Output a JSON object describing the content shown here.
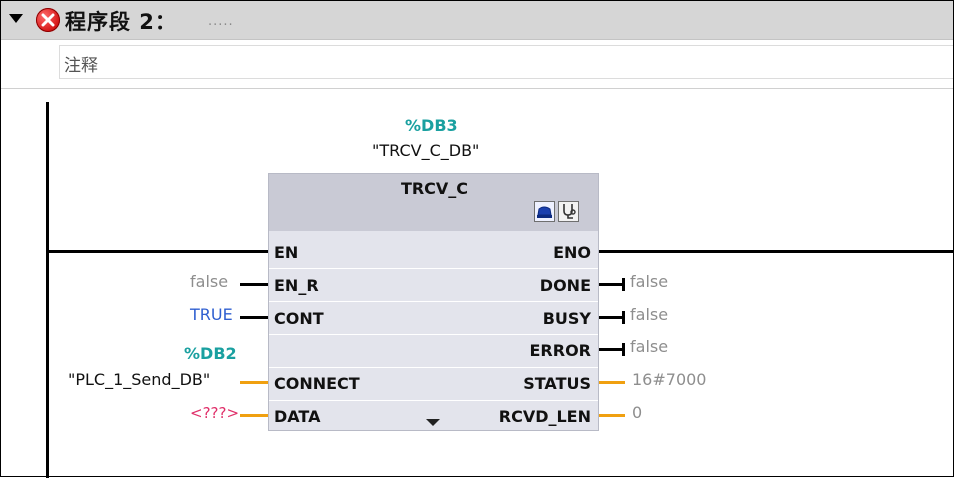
{
  "network": {
    "title": "程序段 2：",
    "dots": ".....",
    "comment": "注释",
    "status_icon": "error-circle-icon"
  },
  "instance_db": {
    "address": "%DB3",
    "name": "\"TRCV_C_DB\""
  },
  "block": {
    "type": "TRCV_C",
    "buttons": [
      "connection-config-icon",
      "diagnostics-icon"
    ],
    "inputs": [
      {
        "pin": "EN",
        "value": ""
      },
      {
        "pin": "EN_R",
        "value": "false"
      },
      {
        "pin": "CONT",
        "value": "TRUE"
      },
      {
        "pin": "CONNECT",
        "value": "\"PLC_1_Send_DB\"",
        "db_address": "%DB2"
      },
      {
        "pin": "DATA",
        "value": "<???>"
      }
    ],
    "outputs": [
      {
        "pin": "ENO",
        "value": ""
      },
      {
        "pin": "DONE",
        "value": "false"
      },
      {
        "pin": "BUSY",
        "value": "false"
      },
      {
        "pin": "ERROR",
        "value": "false"
      },
      {
        "pin": "STATUS",
        "value": "16#7000"
      },
      {
        "pin": "RCVD_LEN",
        "value": "0"
      }
    ]
  },
  "colors": {
    "header_bg": "#d6d6d6",
    "block_bg": "#e3e4ec",
    "db_address": "#1aa0a0",
    "value_gray": "#8e8e8e",
    "value_blue": "#2f5fd0",
    "value_red": "#e0306a",
    "wire_orange": "#f0a010"
  }
}
